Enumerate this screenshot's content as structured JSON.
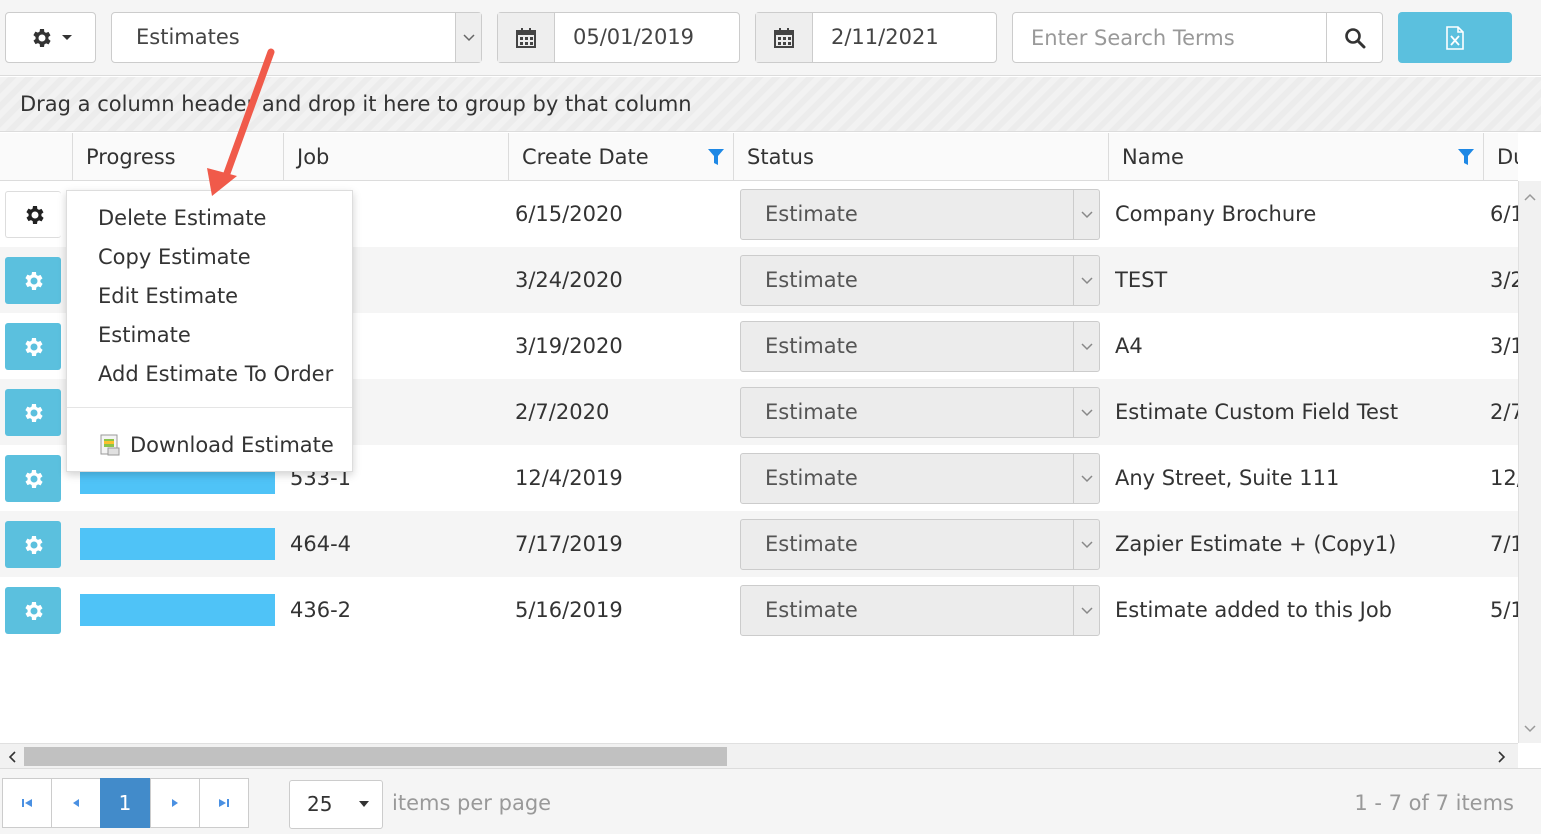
{
  "toolbar": {
    "view_select_value": "Estimates",
    "start_date": "05/01/2019",
    "end_date": "2/11/2021",
    "search_placeholder": "Enter Search Terms"
  },
  "groupbar": {
    "text": "Drag a column header and drop it here to group by that column"
  },
  "columns": {
    "progress": "Progress",
    "job": "Job",
    "create_date": "Create Date",
    "status": "Status",
    "name": "Name",
    "due": "Du"
  },
  "rows": [
    {
      "progress_fraction": 0,
      "job": "",
      "create_date": "6/15/2020",
      "status": "Estimate",
      "name": "Company Brochure",
      "due": "6/1"
    },
    {
      "progress_fraction": 0,
      "job": "",
      "create_date": "3/24/2020",
      "status": "Estimate",
      "name": "TEST",
      "due": "3/2"
    },
    {
      "progress_fraction": 0,
      "job": "",
      "create_date": "3/19/2020",
      "status": "Estimate",
      "name": "A4",
      "due": "3/1"
    },
    {
      "progress_fraction": 0,
      "job": "",
      "create_date": "2/7/2020",
      "status": "Estimate",
      "name": "Estimate Custom Field Test",
      "due": "2/7"
    },
    {
      "progress_fraction": 1,
      "job": "533-1",
      "create_date": "12/4/2019",
      "status": "Estimate",
      "name": "Any Street, Suite 111",
      "due": "12/"
    },
    {
      "progress_fraction": 1,
      "job": "464-4",
      "create_date": "7/17/2019",
      "status": "Estimate",
      "name": "Zapier Estimate + (Copy1)",
      "due": "7/1"
    },
    {
      "progress_fraction": 1,
      "job": "436-2",
      "create_date": "5/16/2019",
      "status": "Estimate",
      "name": "Estimate added to this Job",
      "due": "5/1"
    }
  ],
  "context_menu": {
    "items": [
      "Delete Estimate",
      "Copy Estimate",
      "Edit Estimate",
      "Estimate",
      "Add Estimate To Order"
    ],
    "download": "Download Estimate"
  },
  "pager": {
    "current_page": "1",
    "page_size": "25",
    "items_per_page_label": "items per page",
    "info": "1 - 7 of 7 items"
  },
  "colors": {
    "accent": "#5bc0de",
    "progress": "#4fc3f7",
    "page_active": "#428bca",
    "filter_icon": "#1e88e5",
    "annotation_arrow": "#f05a4a"
  }
}
